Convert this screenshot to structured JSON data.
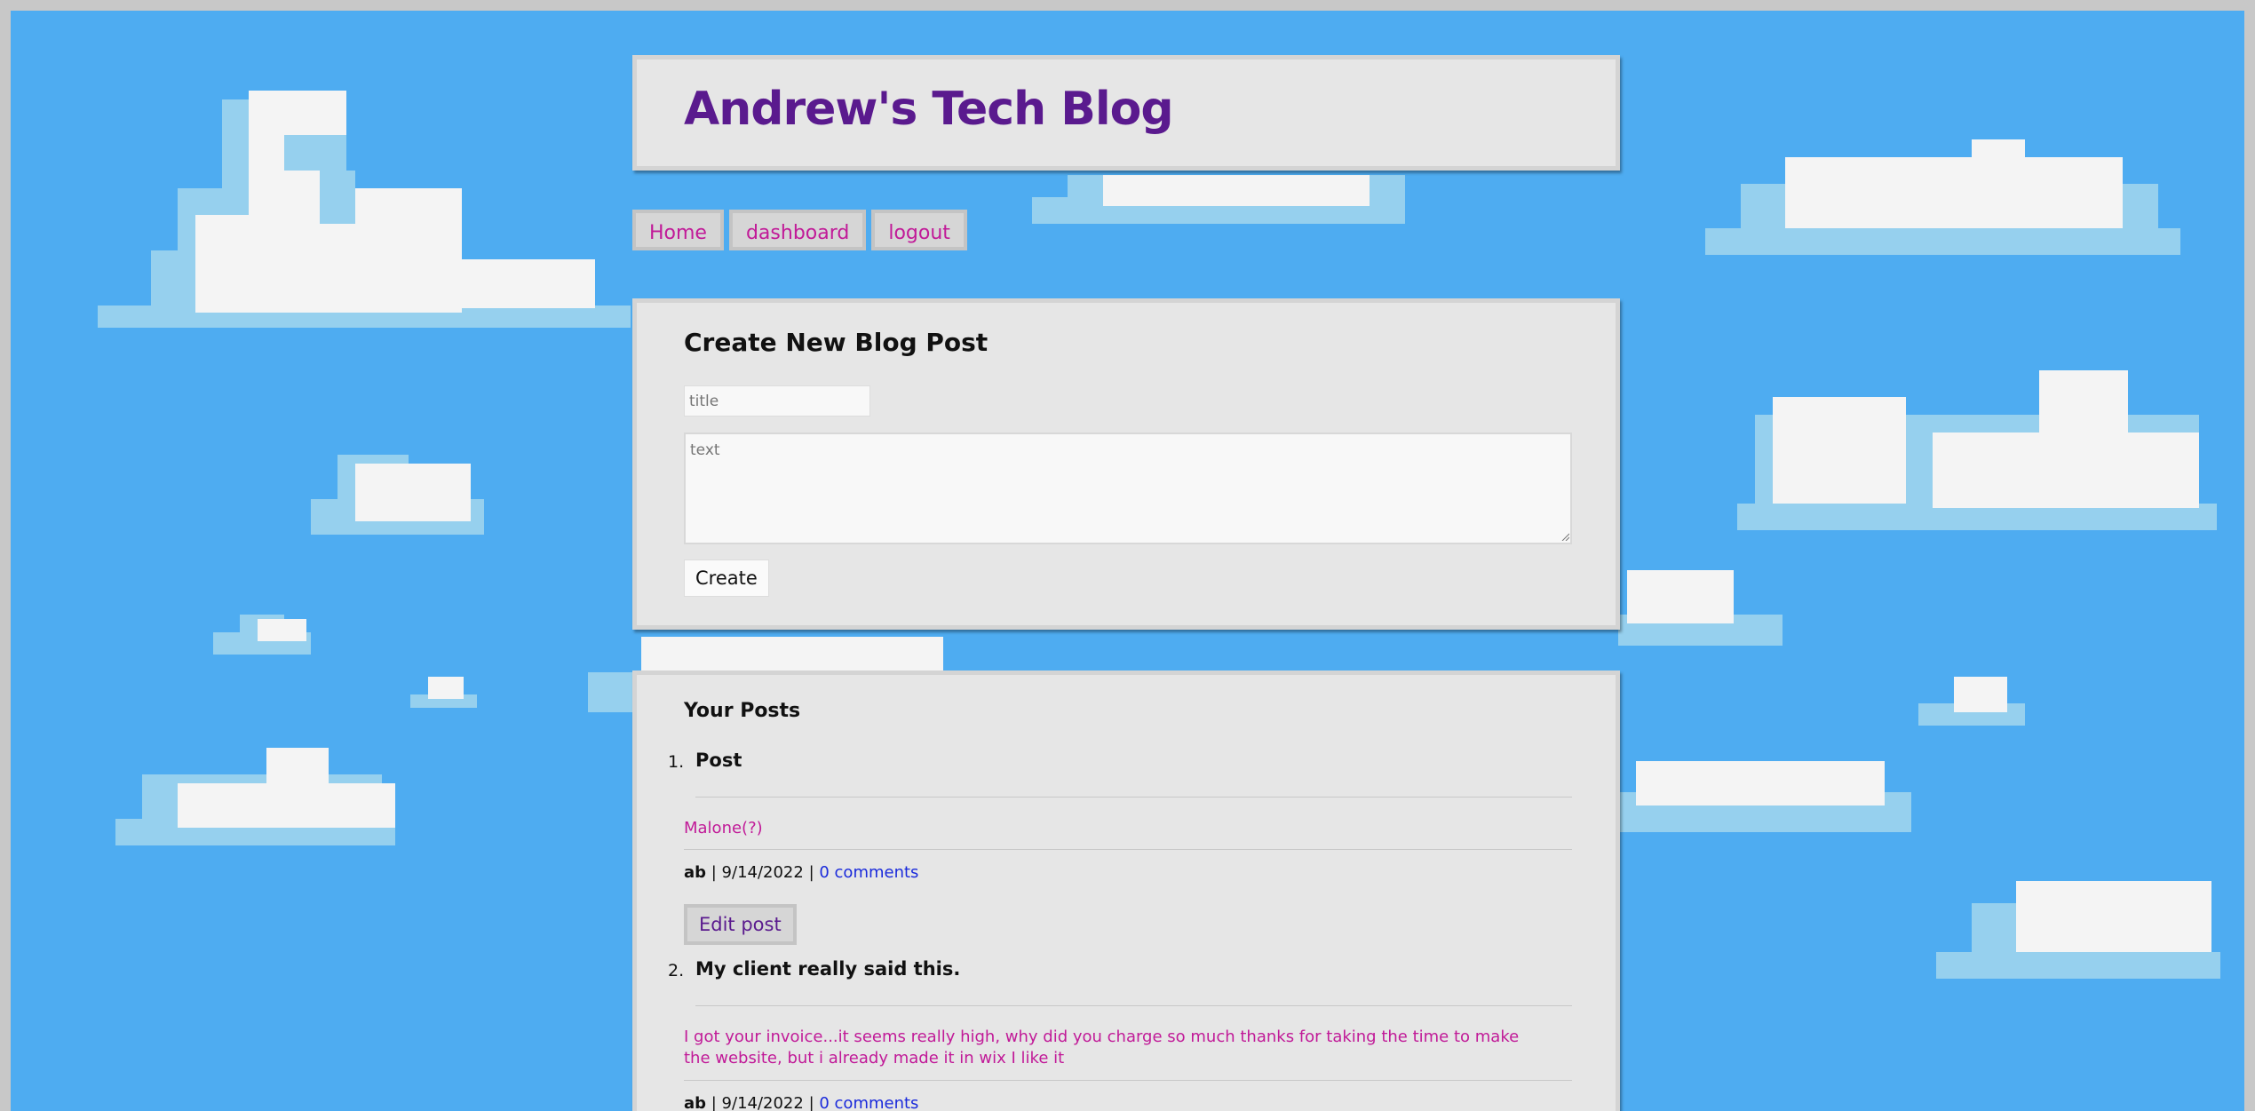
{
  "colors": {
    "sky": "#4eacf1",
    "cloud_white": "#f4f4f4",
    "cloud_shade": "#96d0ee",
    "panel": "#e6e6e6",
    "title": "#5a1a8e",
    "nav_link": "#c11a98",
    "link_blue": "#1a2adb"
  },
  "header": {
    "title": "Andrew's Tech Blog"
  },
  "nav": [
    {
      "label": "Home"
    },
    {
      "label": "dashboard"
    },
    {
      "label": "logout"
    }
  ],
  "create_form": {
    "heading": "Create New Blog Post",
    "title_placeholder": "title",
    "text_placeholder": "text",
    "submit_label": "Create"
  },
  "posts_section": {
    "heading": "Your Posts",
    "posts": [
      {
        "number": "1.",
        "title": "Post",
        "body": "Malone(?)",
        "author": "ab",
        "separator_1": " | ",
        "date": "9/14/2022",
        "separator_2": " | ",
        "comments": "0 comments",
        "edit_label": "Edit post"
      },
      {
        "number": "2.",
        "title": "My client really said this.",
        "body": "I got your invoice...it seems really high, why did you charge so much thanks for taking the time to make the website, but i already made it in wix I like it",
        "author": "ab",
        "separator_1": " | ",
        "date": "9/14/2022",
        "separator_2": " | ",
        "comments": "0 comments"
      }
    ]
  }
}
